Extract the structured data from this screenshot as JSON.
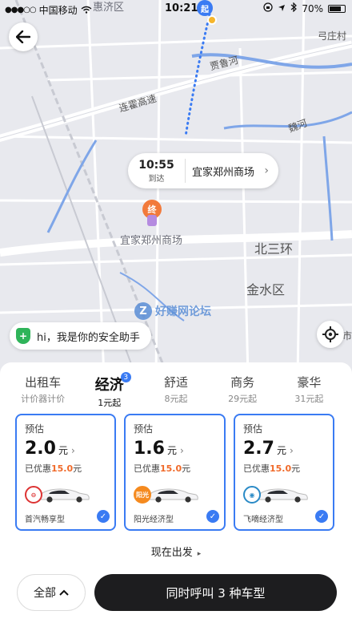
{
  "status_bar": {
    "signal": "●●●○○",
    "carrier": "中国移动",
    "time": "10:21",
    "battery": "70%"
  },
  "map": {
    "labels": {
      "hui_ji": "惠济区",
      "gong_zhuang": "弓庄村",
      "jia_lu_he": "贾鲁河",
      "lian_huo": "连霍高速",
      "wei_he": "魏河",
      "bei_san_huan": "北三环",
      "jin_shui": "金水区",
      "mall": "宜家郑州商场",
      "shi": "市"
    },
    "start_pin": "起",
    "end_pin": "终",
    "watermark": "好赚网论坛"
  },
  "arrival": {
    "time": "10:55",
    "sub": "到达",
    "destination": "宜家郑州商场"
  },
  "safety": {
    "text": "hi，我是你的安全助手"
  },
  "tabs": [
    {
      "name": "出租车",
      "sub": "计价器计价"
    },
    {
      "name": "经济",
      "sub": "1元起",
      "badge": "3"
    },
    {
      "name": "舒适",
      "sub": "8元起"
    },
    {
      "name": "商务",
      "sub": "29元起"
    },
    {
      "name": "豪华",
      "sub": "31元起"
    }
  ],
  "cards": [
    {
      "est": "预估",
      "price": "2.0",
      "unit": "元",
      "discount_prefix": "已优惠",
      "discount_amt": "15.0",
      "discount_unit": "元",
      "car": "首汽畅享型",
      "logo": "首汽"
    },
    {
      "est": "预估",
      "price": "1.6",
      "unit": "元",
      "discount_prefix": "已优惠",
      "discount_amt": "15.0",
      "discount_unit": "元",
      "car": "阳光经济型",
      "logo": "阳光"
    },
    {
      "est": "预估",
      "price": "2.7",
      "unit": "元",
      "discount_prefix": "已优惠",
      "discount_amt": "15.0",
      "discount_unit": "元",
      "car": "飞嘀经济型",
      "logo": "飞嘀"
    }
  ],
  "depart": {
    "text": "现在出发"
  },
  "actions": {
    "all": "全部",
    "call": "同时呼叫 3 种车型"
  },
  "colors": {
    "accent": "#3a7bf3",
    "discount": "#f06a2a",
    "primary_button": "#1d1d1f"
  }
}
